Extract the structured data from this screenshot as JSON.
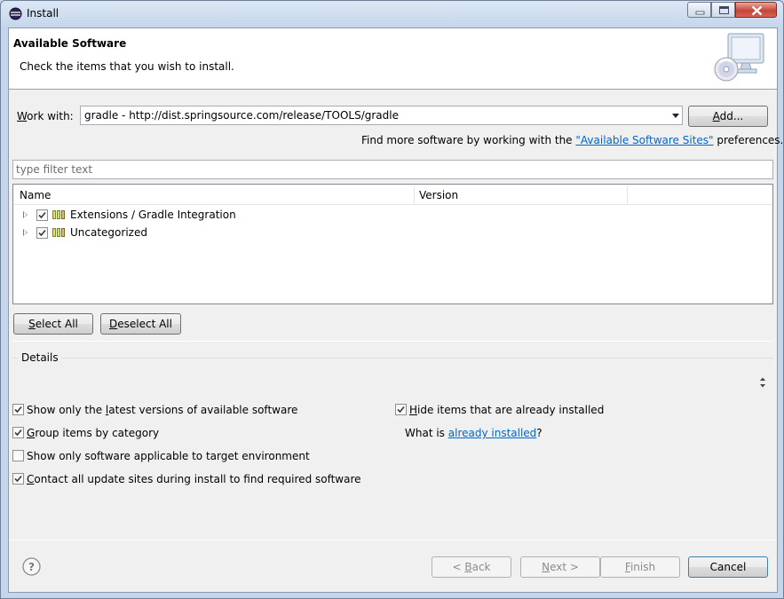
{
  "window": {
    "title": "Install",
    "minimize_label": "minimize",
    "maximize_label": "maximize",
    "close_label": "close"
  },
  "banner": {
    "title": "Available Software",
    "description": "Check the items that you wish to install.",
    "graphic_icon": "install-monitor-cd-icon"
  },
  "work_with": {
    "label": "Work with:",
    "value": "gradle - http://dist.springsource.com/release/TOOLS/gradle",
    "add_button": "Add..."
  },
  "find_more": {
    "prefix": "Find more software by working with the ",
    "link": "\"Available Software Sites\"",
    "suffix": " preferences."
  },
  "filter": {
    "placeholder": "type filter text"
  },
  "tree": {
    "columns": [
      "Name",
      "Version"
    ],
    "rows": [
      {
        "label": "Extensions / Gradle Integration",
        "checked": true,
        "version": ""
      },
      {
        "label": "Uncategorized",
        "checked": true,
        "version": ""
      }
    ]
  },
  "selection_buttons": {
    "select_all": "Select All",
    "deselect_all": "Deselect All"
  },
  "details": {
    "label": "Details",
    "content": ""
  },
  "options": {
    "show_latest": {
      "label": "Show only the latest versions of available software",
      "checked": true
    },
    "group_by_category": {
      "label": "Group items by category",
      "checked": true
    },
    "show_applicable": {
      "label": "Show only software applicable to target environment",
      "checked": false
    },
    "contact_sites": {
      "label": "Contact all update sites during install to find required software",
      "checked": true
    },
    "hide_installed": {
      "label": "Hide items that are already installed",
      "checked": true
    },
    "what_is": {
      "prefix": "What is ",
      "link": "already installed",
      "suffix": "?"
    }
  },
  "footer": {
    "back": "< Back",
    "next": "Next >",
    "finish": "Finish",
    "cancel": "Cancel"
  },
  "colors": {
    "link": "#0066cc",
    "dialog_bg": "#f0f0f0",
    "banner_bg": "#ffffff",
    "close_button": "#c7473a"
  }
}
